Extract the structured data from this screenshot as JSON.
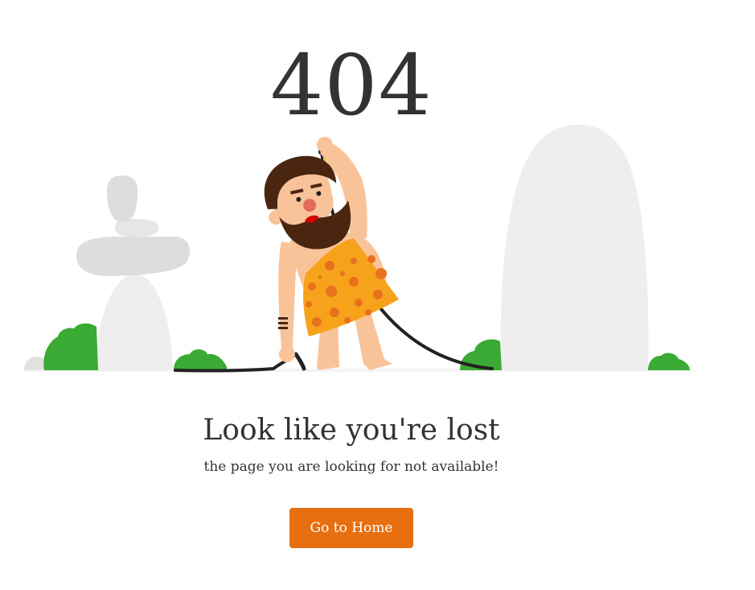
{
  "error": {
    "code": "404"
  },
  "message": {
    "heading": "Look like you're lost",
    "subtext": "the page you are looking for not available!"
  },
  "actions": {
    "home_label": "Go to Home"
  },
  "illustration": {
    "subject": "caveman-with-cable",
    "colors": {
      "rock": "#EEEEEE",
      "rock_dark": "#DDDDDD",
      "bush": "#3AAA35",
      "skin": "#F9C39A",
      "hair": "#4A2610",
      "tunic": "#F7A21B",
      "tunic_spots": "#E8711E",
      "cable": "#222222"
    }
  },
  "theme": {
    "text_color": "#333333",
    "button_color": "#E86F10",
    "button_text_color": "#FFFFFF",
    "background": "#FFFFFF"
  }
}
